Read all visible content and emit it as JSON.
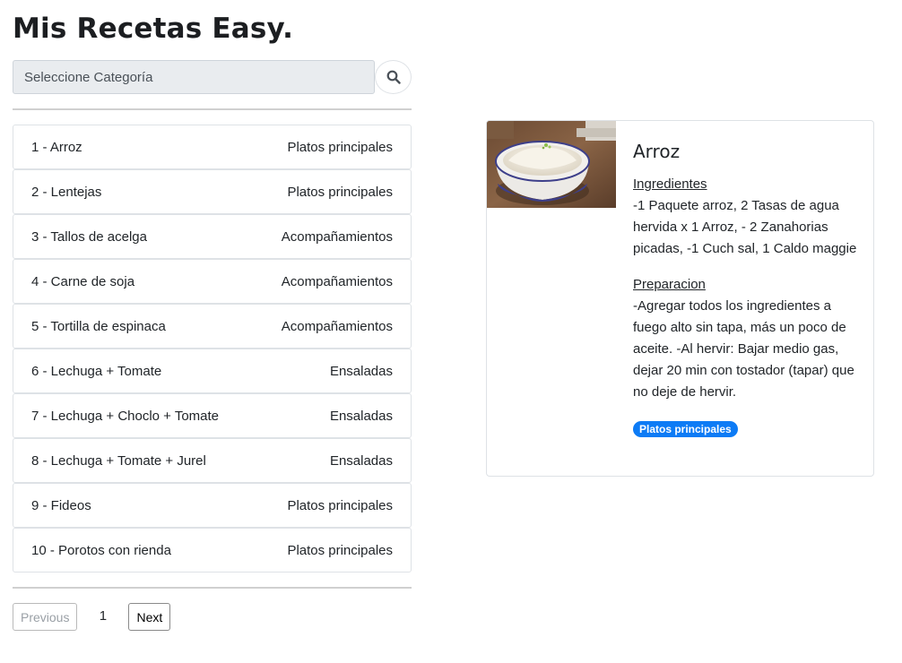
{
  "app": {
    "title": "Mis Recetas Easy."
  },
  "search": {
    "placeholder": "Seleccione Categoría",
    "button_icon": "search-icon"
  },
  "recipes": [
    {
      "name": "1 - Arroz",
      "category": "Platos principales"
    },
    {
      "name": "2 - Lentejas",
      "category": "Platos principales"
    },
    {
      "name": "3 - Tallos de acelga",
      "category": "Acompañamientos"
    },
    {
      "name": "4 - Carne de soja",
      "category": "Acompañamientos"
    },
    {
      "name": "5 - Tortilla de espinaca",
      "category": "Acompañamientos"
    },
    {
      "name": "6 - Lechuga + Tomate",
      "category": "Ensaladas"
    },
    {
      "name": "7 - Lechuga + Choclo + Tomate",
      "category": "Ensaladas"
    },
    {
      "name": "8 - Lechuga + Tomate + Jurel",
      "category": "Ensaladas"
    },
    {
      "name": "9 - Fideos",
      "category": "Platos principales"
    },
    {
      "name": "10 - Porotos con rienda",
      "category": "Platos principales"
    }
  ],
  "pagination": {
    "previous": "Previous",
    "page": "1",
    "next": "Next"
  },
  "detail": {
    "title": "Arroz",
    "ingredients_label": "Ingredientes",
    "ingredients_text": "-1 Paquete arroz, 2 Tasas de agua hervida x 1 Arroz, - 2 Zanahorias picadas, -1 Cuch sal, 1 Caldo maggie",
    "preparation_label": "Preparacion",
    "preparation_text": "-Agregar todos los ingredientes a fuego alto sin tapa, más un poco de aceite. -Al hervir: Bajar medio gas, dejar 20 min con tostador (tapar) que no deje de hervir.",
    "category_badge": "Platos principales"
  },
  "colors": {
    "badge": "#0d7bf5",
    "input_bg": "#e9ecef",
    "border": "#dee2e6"
  }
}
